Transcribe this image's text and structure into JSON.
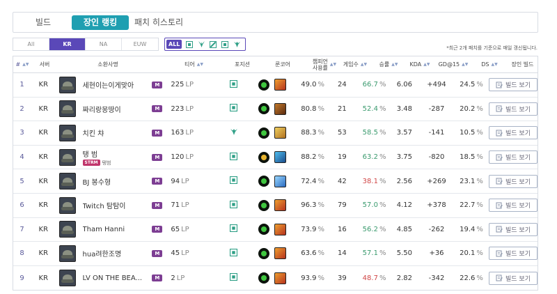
{
  "tabs": [
    {
      "label": "빌드"
    },
    {
      "label": "장인 랭킹"
    },
    {
      "label": "패치 히스토리"
    }
  ],
  "regions": [
    "All",
    "KR",
    "NA",
    "EUW"
  ],
  "position_filter": {
    "all_label": "ALL"
  },
  "notice": "*최근 2개 패치를 기준으로 매일 갱신됩니다.",
  "columns": {
    "rank": "#",
    "server": "서버",
    "summoner": "소환사명",
    "tier": "티어",
    "position": "포지션",
    "rune_core": "룬코어",
    "pick_rate_l1": "챔피언",
    "pick_rate_l2": "사용률",
    "games": "게임수",
    "winrate": "승률",
    "kda": "KDA",
    "gd15": "GD@15",
    "ds": "DS",
    "build": "장인 빌드"
  },
  "units": {
    "lp": "LP",
    "percent": "%"
  },
  "build_button_label": "빌드 보기",
  "colors": {
    "accent": "#1f9fb1",
    "region_active": "#5a48b8",
    "tier_master": "#7d3e93",
    "win_high": "#3a9a6e",
    "win_low": "#d04545"
  },
  "rows": [
    {
      "rank": "1",
      "server": "KR",
      "name": "세현이는이게맞아",
      "team": "",
      "team_name": "",
      "tier": "M",
      "lp": "225",
      "position": "jungle-icon",
      "rune": "green",
      "item": "orange",
      "pick": "49.0",
      "games": "24",
      "win": "66.7",
      "kda": "6.06",
      "gd": "+494",
      "ds": "24.5"
    },
    {
      "rank": "2",
      "server": "KR",
      "name": "짜리랑몽땅이",
      "team": "",
      "team_name": "",
      "tier": "M",
      "lp": "223",
      "position": "jungle-icon",
      "rune": "green",
      "item": "brown",
      "pick": "80.8",
      "games": "21",
      "win": "52.4",
      "kda": "3.48",
      "gd": "-287",
      "ds": "20.2"
    },
    {
      "rank": "3",
      "server": "KR",
      "name": "치킨 챠",
      "team": "",
      "team_name": "",
      "tier": "M",
      "lp": "163",
      "position": "support-icon",
      "rune": "green",
      "item": "gold",
      "pick": "88.3",
      "games": "53",
      "win": "58.5",
      "kda": "3.57",
      "gd": "-141",
      "ds": "10.5"
    },
    {
      "rank": "4",
      "server": "KR",
      "name": "탱 범",
      "team": "STRM",
      "team_name": "탱범",
      "tier": "M",
      "lp": "120",
      "position": "jungle-icon",
      "rune": "yellow",
      "item": "blue",
      "pick": "88.2",
      "games": "19",
      "win": "63.2",
      "kda": "3.75",
      "gd": "-820",
      "ds": "18.5"
    },
    {
      "rank": "5",
      "server": "KR",
      "name": "BJ 봉수형",
      "team": "",
      "team_name": "",
      "tier": "M",
      "lp": "94",
      "position": "jungle-icon",
      "rune": "green",
      "item": "lightblue",
      "pick": "72.4",
      "games": "42",
      "win": "38.1",
      "kda": "2.56",
      "gd": "+269",
      "ds": "23.1"
    },
    {
      "rank": "6",
      "server": "KR",
      "name": "Twitch 탐탐이",
      "team": "",
      "team_name": "",
      "tier": "M",
      "lp": "71",
      "position": "jungle-icon",
      "rune": "green",
      "item": "orange",
      "pick": "96.3",
      "games": "79",
      "win": "57.0",
      "kda": "4.12",
      "gd": "+378",
      "ds": "22.7"
    },
    {
      "rank": "7",
      "server": "KR",
      "name": "Tham Hanni",
      "team": "",
      "team_name": "",
      "tier": "M",
      "lp": "65",
      "position": "jungle-icon",
      "rune": "green",
      "item": "orange",
      "pick": "73.9",
      "games": "16",
      "win": "56.2",
      "kda": "4.85",
      "gd": "-262",
      "ds": "19.4"
    },
    {
      "rank": "8",
      "server": "KR",
      "name": "hua려한조명",
      "team": "",
      "team_name": "",
      "tier": "M",
      "lp": "45",
      "position": "jungle-icon",
      "rune": "green",
      "item": "orange",
      "pick": "63.6",
      "games": "14",
      "win": "57.1",
      "kda": "5.50",
      "gd": "+36",
      "ds": "20.1"
    },
    {
      "rank": "9",
      "server": "KR",
      "name": "LV ON THE BEA...",
      "team": "",
      "team_name": "",
      "tier": "M",
      "lp": "2",
      "position": "jungle-icon",
      "rune": "green",
      "item": "orange",
      "pick": "93.9",
      "games": "39",
      "win": "48.7",
      "kda": "2.82",
      "gd": "-342",
      "ds": "22.6"
    }
  ]
}
